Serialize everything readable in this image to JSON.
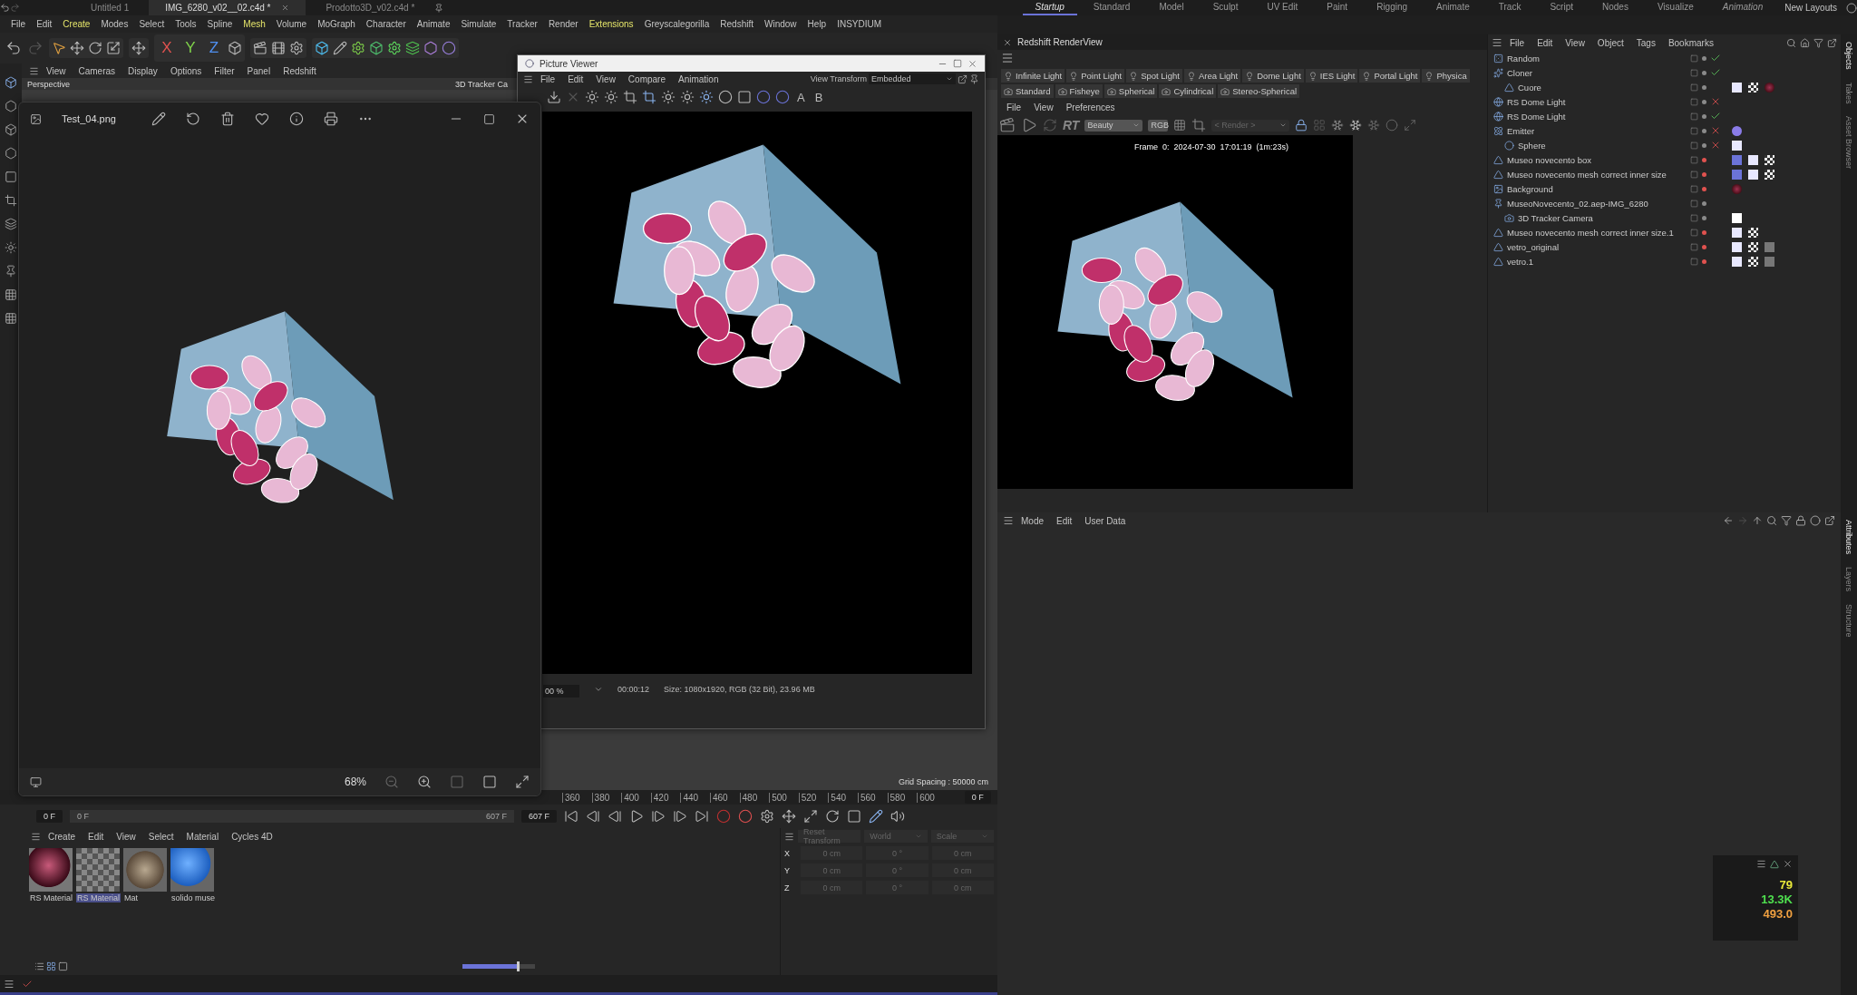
{
  "doc_tabs": [
    {
      "label": "Untitled 1",
      "selected": false
    },
    {
      "label": "IMG_6280_v02__02.c4d *",
      "selected": true
    },
    {
      "label": "Prodotto3D_v02.c4d *",
      "selected": false
    }
  ],
  "layouts": [
    {
      "label": "Startup",
      "selected": true
    },
    {
      "label": "Standard",
      "selected": false
    },
    {
      "label": "Model",
      "selected": false
    },
    {
      "label": "Sculpt",
      "selected": false
    },
    {
      "label": "UV Edit",
      "selected": false
    },
    {
      "label": "Paint",
      "selected": false
    },
    {
      "label": "Rigging",
      "selected": false
    },
    {
      "label": "Animate",
      "selected": false
    },
    {
      "label": "Track",
      "selected": false
    },
    {
      "label": "Script",
      "selected": false
    },
    {
      "label": "Nodes",
      "selected": false
    },
    {
      "label": "Visualize",
      "selected": false
    },
    {
      "label": "Animation",
      "selected": false
    }
  ],
  "new_layouts": "New Layouts",
  "menu": [
    {
      "label": "File",
      "kind": "plain"
    },
    {
      "label": "Edit",
      "kind": "plain"
    },
    {
      "label": "Create",
      "kind": "accent"
    },
    {
      "label": "Modes",
      "kind": "plain"
    },
    {
      "label": "Select",
      "kind": "plain"
    },
    {
      "label": "Tools",
      "kind": "plain"
    },
    {
      "label": "Spline",
      "kind": "plain"
    },
    {
      "label": "Mesh",
      "kind": "accent"
    },
    {
      "label": "Volume",
      "kind": "plain"
    },
    {
      "label": "MoGraph",
      "kind": "plain"
    },
    {
      "label": "Character",
      "kind": "plain"
    },
    {
      "label": "Animate",
      "kind": "plain"
    },
    {
      "label": "Simulate",
      "kind": "plain"
    },
    {
      "label": "Tracker",
      "kind": "plain"
    },
    {
      "label": "Render",
      "kind": "plain"
    },
    {
      "label": "Extensions",
      "kind": "accent"
    },
    {
      "label": "Greyscalegorilla",
      "kind": "plain"
    },
    {
      "label": "Redshift",
      "kind": "plain"
    },
    {
      "label": "Window",
      "kind": "plain"
    },
    {
      "label": "Help",
      "kind": "plain"
    },
    {
      "label": "INSYDIUM",
      "kind": "plain"
    }
  ],
  "axis_buttons": [
    {
      "label": "X",
      "color": "#e0524f"
    },
    {
      "label": "Y",
      "color": "#7fd24a"
    },
    {
      "label": "Z",
      "color": "#4f8ff0"
    }
  ],
  "viewport": {
    "menu": [
      "View",
      "Cameras",
      "Display",
      "Options",
      "Filter",
      "Panel",
      "Redshift"
    ],
    "camera": "Perspective",
    "tracker_label": "3D Tracker Ca",
    "grid_spacing": "Grid Spacing : 50000 cm"
  },
  "photos_window": {
    "file": "Test_04.png",
    "zoom": "68%"
  },
  "picture_viewer": {
    "title": "Picture Viewer",
    "menu": [
      "File",
      "Edit",
      "View",
      "Compare",
      "Animation"
    ],
    "view_transform_label": "View Transform",
    "view_transform": "Embedded",
    "compare": [
      "A",
      "B"
    ],
    "zoom": "00 %",
    "time": "00:00:12",
    "info": "Size: 1080x1920, RGB (32 Bit), 23.96 MB"
  },
  "timeline": {
    "ticks": [
      "360",
      "380",
      "400",
      "420",
      "440",
      "460",
      "480",
      "500",
      "520",
      "540",
      "560",
      "580",
      "600"
    ],
    "current": "0 F",
    "start": "0 F",
    "range_start": "0 F",
    "range_end": "607 F",
    "end": "607 F"
  },
  "materials": {
    "menu": [
      "Create",
      "Edit",
      "View",
      "Select",
      "Material",
      "Cycles 4D"
    ],
    "items": [
      {
        "name": "RS Material",
        "kind": "glossy",
        "selected": false
      },
      {
        "name": "RS Material",
        "kind": "checker",
        "selected": true
      },
      {
        "name": "Mat",
        "kind": "building",
        "selected": false
      },
      {
        "name": "solido muse",
        "kind": "sphere",
        "selected": false
      }
    ],
    "zoom_slider": {
      "level": 0.75
    }
  },
  "coordinates": {
    "reset": "Reset Transform",
    "space": "World",
    "mode": "Scale",
    "rows": [
      {
        "axis": "X",
        "position": "0 cm",
        "rotation": "0 °",
        "size": "0 cm"
      },
      {
        "axis": "Y",
        "position": "0 cm",
        "rotation": "0 °",
        "size": "0 cm"
      },
      {
        "axis": "Z",
        "position": "0 cm",
        "rotation": "0 °",
        "size": "0 cm"
      }
    ]
  },
  "redshift": {
    "title": "Redshift RenderView",
    "lights": [
      "Infinite Light",
      "Point Light",
      "Spot Light",
      "Area Light",
      "Dome Light",
      "IES Light",
      "Portal Light",
      "Physica"
    ],
    "cameras": [
      "Standard",
      "Fisheye",
      "Spherical",
      "Cylindrical",
      "Stereo-Spherical"
    ],
    "menu": [
      "File",
      "View",
      "Preferences"
    ],
    "rt": "RT",
    "aov": "Beauty",
    "rgb": "RGB",
    "render_mode": "< Render >",
    "frame_info": "Frame  0:  2024-07-30  17:01:19  (1m:23s)"
  },
  "objects": {
    "menu": [
      "File",
      "Edit",
      "View",
      "Object",
      "Tags",
      "Bookmarks"
    ],
    "items": [
      {
        "name": "Random",
        "kind": "effector",
        "enabled": true,
        "color": "#8a8a8a"
      },
      {
        "name": "Cloner",
        "kind": "cloner",
        "enabled": true,
        "color": "#8a8a8a",
        "children": [
          {
            "name": "Cuore",
            "kind": "mesh",
            "color": "#8a8a8a",
            "tags": [
              {
                "kind": "phong"
              },
              {
                "kind": "checker"
              },
              {
                "kind": "material"
              }
            ]
          }
        ]
      },
      {
        "name": "RS Dome Light",
        "kind": "light",
        "enabled": false,
        "color": "#8a8a8a"
      },
      {
        "name": "RS Dome Light",
        "kind": "light",
        "enabled": true,
        "color": "#8a8a8a"
      },
      {
        "name": "Emitter",
        "kind": "emitter",
        "enabled": false,
        "color": "#8a8a8a",
        "tags": [
          {
            "kind": "particle"
          }
        ],
        "children": [
          {
            "name": "Sphere",
            "kind": "sphere",
            "enabled": false,
            "color": "#8a8a8a",
            "tags": [
              {
                "kind": "phong"
              }
            ]
          }
        ]
      },
      {
        "name": "Museo novecento box",
        "kind": "mesh",
        "color": "#e0524f",
        "tags": [
          {
            "kind": "grid"
          },
          {
            "kind": "phong"
          },
          {
            "kind": "checker"
          }
        ]
      },
      {
        "name": "Museo novecento mesh correct inner size",
        "kind": "mesh",
        "color": "#e0524f",
        "tags": [
          {
            "kind": "grid"
          },
          {
            "kind": "phong"
          },
          {
            "kind": "checker"
          }
        ]
      },
      {
        "name": "Background",
        "kind": "background",
        "color": "#e0524f",
        "tags": [
          {
            "kind": "material"
          }
        ]
      },
      {
        "name": "MuseoNovecento_02.aep-IMG_6280",
        "kind": "null",
        "color": "#8a8a8a",
        "children": [
          {
            "name": "3D Tracker Camera",
            "kind": "camera",
            "color": "#8a8a8a",
            "tags": [
              {
                "kind": "target"
              }
            ]
          }
        ]
      },
      {
        "name": "Museo novecento mesh correct inner size.1",
        "kind": "mesh",
        "color": "#e0524f",
        "tags": [
          {
            "kind": "phong"
          },
          {
            "kind": "checker"
          }
        ]
      },
      {
        "name": "vetro_original",
        "kind": "mesh",
        "color": "#e0524f",
        "tags": [
          {
            "kind": "phong"
          },
          {
            "kind": "checker"
          },
          {
            "kind": "noise"
          }
        ]
      },
      {
        "name": "vetro.1",
        "kind": "mesh",
        "color": "#e0524f",
        "tags": [
          {
            "kind": "phong"
          },
          {
            "kind": "checker"
          },
          {
            "kind": "noise"
          }
        ]
      }
    ]
  },
  "right_tabs_top": [
    {
      "label": "Objects",
      "selected": true
    },
    {
      "label": "Takes",
      "selected": false
    },
    {
      "label": "Asset Browser",
      "selected": false
    }
  ],
  "attributes": {
    "menu": [
      "Mode",
      "Edit",
      "User Data"
    ]
  },
  "right_tabs_bottom": [
    {
      "label": "Attributes",
      "selected": true
    },
    {
      "label": "Layers",
      "selected": false
    },
    {
      "label": "Structure",
      "selected": false
    }
  ],
  "stats": [
    {
      "value": "79",
      "color": "#e8e83a"
    },
    {
      "value": "13.3K",
      "color": "#4fe04f"
    },
    {
      "value": "493.0",
      "color": "#f0a040"
    }
  ]
}
